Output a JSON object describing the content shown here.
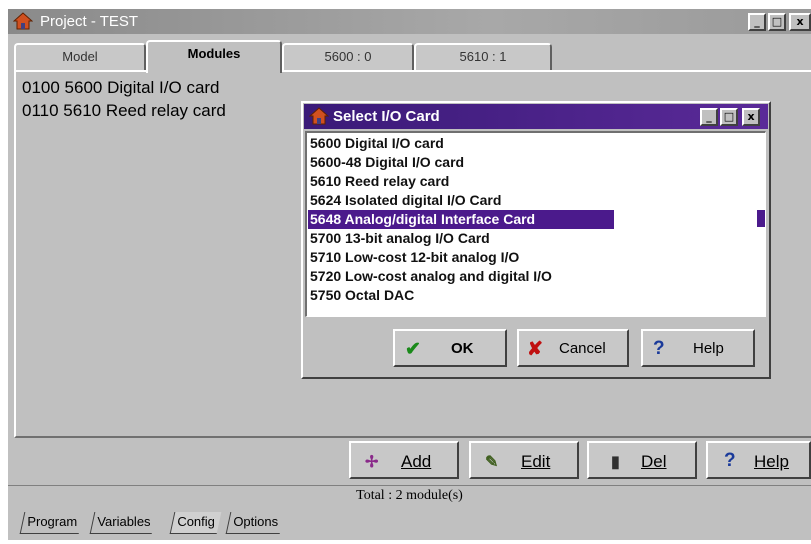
{
  "window": {
    "title": "Project - TEST",
    "controls": [
      "_",
      "□",
      "x"
    ]
  },
  "tabs": [
    {
      "label": "Model"
    },
    {
      "label": "Modules"
    },
    {
      "label": "5600 : 0"
    },
    {
      "label": "5610 : 1"
    }
  ],
  "modules": [
    "0100  5600 Digital I/O card",
    "0110  5610 Reed relay card"
  ],
  "dialog": {
    "title": "Select I/O Card",
    "controls": [
      "_",
      "□",
      "x"
    ],
    "cards": [
      "5600 Digital I/O card",
      "5600-48 Digital I/O card",
      "5610 Reed relay card",
      "5624 Isolated digital I/O Card",
      "5648 Analog/digital Interface Card",
      "5700 13-bit analog I/O Card",
      "5710 Low-cost 12-bit analog I/O",
      "5720 Low-cost analog and digital I/O",
      "5750 Octal DAC"
    ],
    "selected_index": 4,
    "buttons": {
      "ok": "OK",
      "cancel": "Cancel",
      "help": "Help"
    }
  },
  "actions": {
    "add": "Add",
    "edit": "Edit",
    "del": "Del",
    "help": "Help"
  },
  "status": "Total : 2 module(s)",
  "bottom_tabs": [
    "Program",
    "Variables",
    "Config",
    "Options"
  ],
  "colors": {
    "selection": "#4b1a8c",
    "dialog_title": "#3a1a78",
    "window_face": "#c0c0c0"
  }
}
